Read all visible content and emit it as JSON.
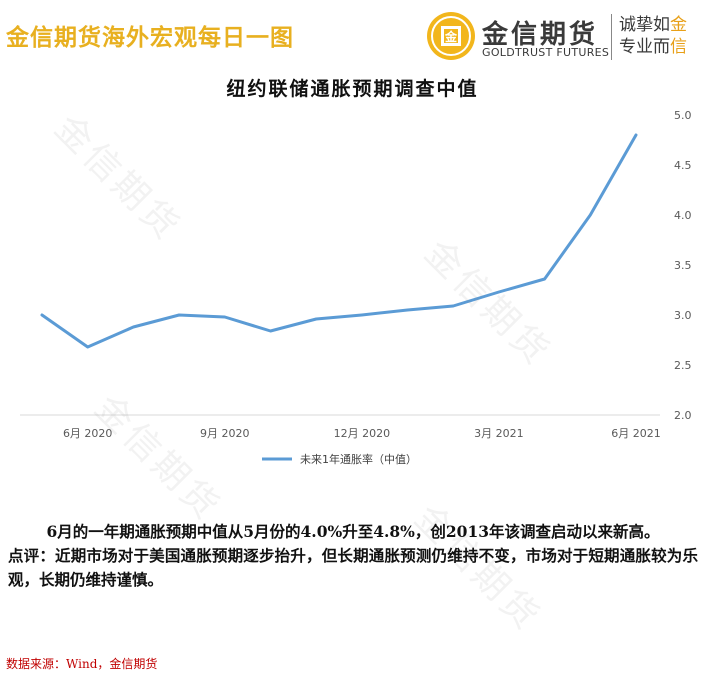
{
  "header": {
    "report_title": "金信期货海外宏观每日一图",
    "logo_cn": "金信期货",
    "logo_en": "GOLDTRUST FUTURES",
    "slogan_line1_dark": "诚挚如",
    "slogan_line1_gold": "金",
    "slogan_line2_dark": "专业而",
    "slogan_line2_gold": "信",
    "emblem_char": "金",
    "title_color": "#E8B020",
    "gold_color": "#E8A018"
  },
  "watermark_text": "金信期货",
  "chart_data": {
    "type": "line",
    "title": "纽约联储通胀预期调查中值",
    "x": [
      "2020-05",
      "2020-06",
      "2020-07",
      "2020-08",
      "2020-09",
      "2020-10",
      "2020-11",
      "2020-12",
      "2021-01",
      "2021-02",
      "2021-03",
      "2021-04",
      "2021-05",
      "2021-06"
    ],
    "x_tick_labels": [
      {
        "x": "2020-06",
        "label": "6月 2020"
      },
      {
        "x": "2020-09",
        "label": "9月 2020"
      },
      {
        "x": "2020-12",
        "label": "12月 2020"
      },
      {
        "x": "2021-03",
        "label": "3月 2021"
      },
      {
        "x": "2021-06",
        "label": "6月 2021"
      }
    ],
    "series": [
      {
        "name": "未来1年通胀率（中值）",
        "color": "#5B9BD5",
        "values": [
          3.0,
          2.68,
          2.88,
          3.0,
          2.98,
          2.84,
          2.96,
          3.0,
          3.05,
          3.09,
          3.23,
          3.36,
          4.0,
          4.8
        ]
      }
    ],
    "y_axis_side": "right",
    "ylim": [
      2.0,
      5.0
    ],
    "yticks": [
      2.0,
      2.5,
      3.0,
      3.5,
      4.0,
      4.5,
      5.0
    ],
    "ytick_labels": [
      "2.0",
      "2.5",
      "3.0",
      "3.5",
      "4.0",
      "4.5",
      "5.0"
    ],
    "grid": false,
    "legend_position": "bottom"
  },
  "description": {
    "line1": "6月的一年期通胀预期中值从5月份的4.0%升至4.8%，创2013年该调查启动以来新高。",
    "comment": "点评：近期市场对于美国通胀预期逐步抬升，但长期通胀预测仍维持不变，市场对于短期通胀较为乐观，长期仍维持谨慎。"
  },
  "source": "数据来源：Wind，金信期货"
}
